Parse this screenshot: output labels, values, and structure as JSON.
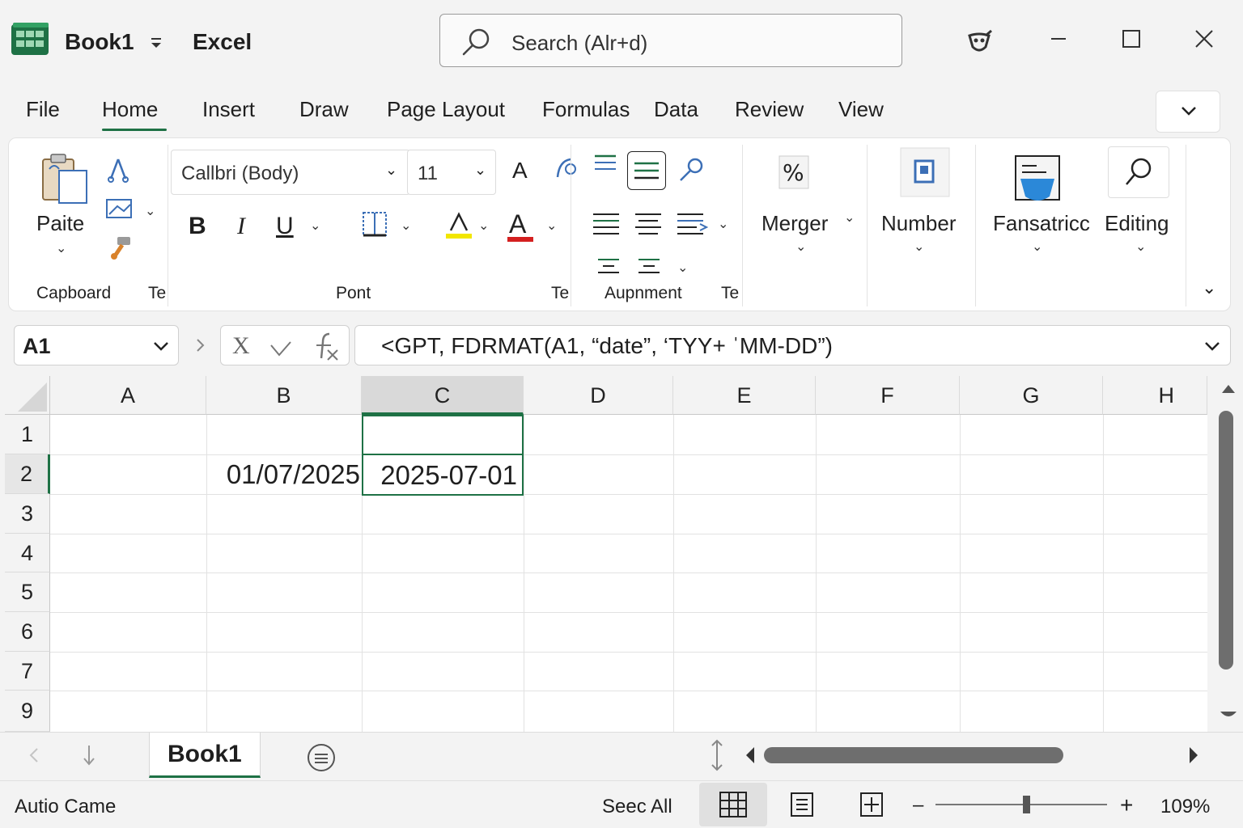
{
  "title_bar": {
    "book_name": "Book1",
    "app_name": "Excel",
    "search_placeholder": "Search (Alr+d)"
  },
  "menu_tabs": [
    "File",
    "Home",
    "Insert",
    "Draw",
    "Page Layout",
    "Formulas",
    "Data",
    "Review",
    "View"
  ],
  "active_tab": "Home",
  "ribbon": {
    "paste_label": "Paite",
    "clipboard_group": "Capboard",
    "te_label": "Te",
    "font_name": "Callbri (Body)",
    "font_size": "11",
    "bold": "B",
    "italic": "I",
    "underline": "U",
    "font_grow": "A",
    "font_color_glyph": "A",
    "font_group": "Pont",
    "alignment_group": "Aupnment",
    "merge_label": "Merger",
    "number_label": "Number",
    "styles_label": "Fansatricc",
    "editing_label": "Editing",
    "accent_color": "#1e7145",
    "highlight_color": "#f2e600",
    "font_color": "#d42020"
  },
  "formula_bar": {
    "name_box": "A1",
    "cancel_glyph": "X",
    "formula": "<GPT, FDRMAT(A1, “date”, ‘TYY+ ˈMM-DD”)"
  },
  "grid": {
    "columns": [
      "A",
      "B",
      "C",
      "D",
      "E",
      "F",
      "G",
      "H"
    ],
    "rows": [
      "1",
      "2",
      "3",
      "4",
      "5",
      "6",
      "7",
      "9"
    ],
    "selected_column": "C",
    "cells": {
      "B2": "01/07/2025",
      "C2": "2025-07-01"
    }
  },
  "sheets": {
    "active_sheet": "Book1"
  },
  "status_bar": {
    "left_text": "Autio Came",
    "see_all": "Seec All",
    "zoom": "109%",
    "zoom_minus": "–",
    "zoom_plus": "+"
  }
}
